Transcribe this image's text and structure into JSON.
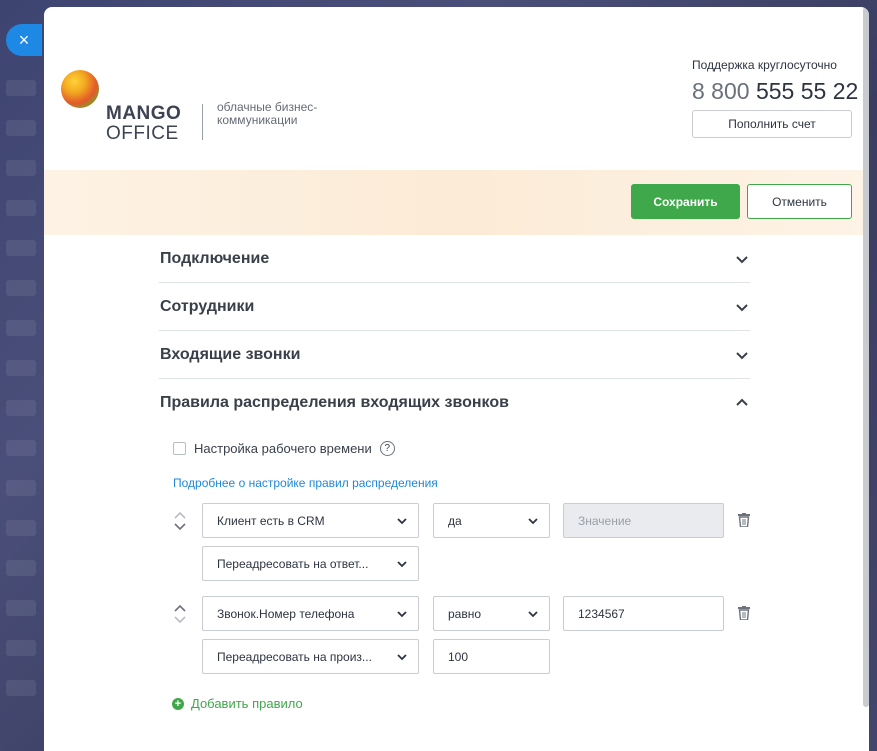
{
  "close_glyph": "×",
  "logo": {
    "line1": "MANGO",
    "line2": "OFFICE",
    "tagline": "облачные бизнес-коммуникации"
  },
  "support": {
    "label": "Поддержка круглосуточно",
    "phone_prefix": "8 800",
    "phone_number": "555 55 22",
    "topup_label": "Пополнить счет"
  },
  "actions": {
    "save_label": "Сохранить",
    "cancel_label": "Отменить"
  },
  "sections": {
    "s1": "Подключение",
    "s2": "Сотрудники",
    "s3": "Входящие звонки",
    "s4": "Правила распределения входящих звонков"
  },
  "rules": {
    "worktime_label": "Настройка рабочего времени",
    "help_glyph": "?",
    "more_link": "Подробнее о настройке правил распределения",
    "rule1": {
      "condition": "Клиент есть в CRM",
      "operator": "да",
      "value_placeholder": "Значение",
      "action": "Переадресовать на ответ..."
    },
    "rule2": {
      "condition": "Звонок.Номер телефона",
      "operator": "равно",
      "value": "1234567",
      "action": "Переадресовать на произ...",
      "action_value": "100"
    },
    "add_glyph": "+",
    "add_label": "Добавить правило"
  },
  "colors": {
    "accent": "#3fa84a",
    "link": "#1f88d8",
    "close": "#1e88e5"
  }
}
